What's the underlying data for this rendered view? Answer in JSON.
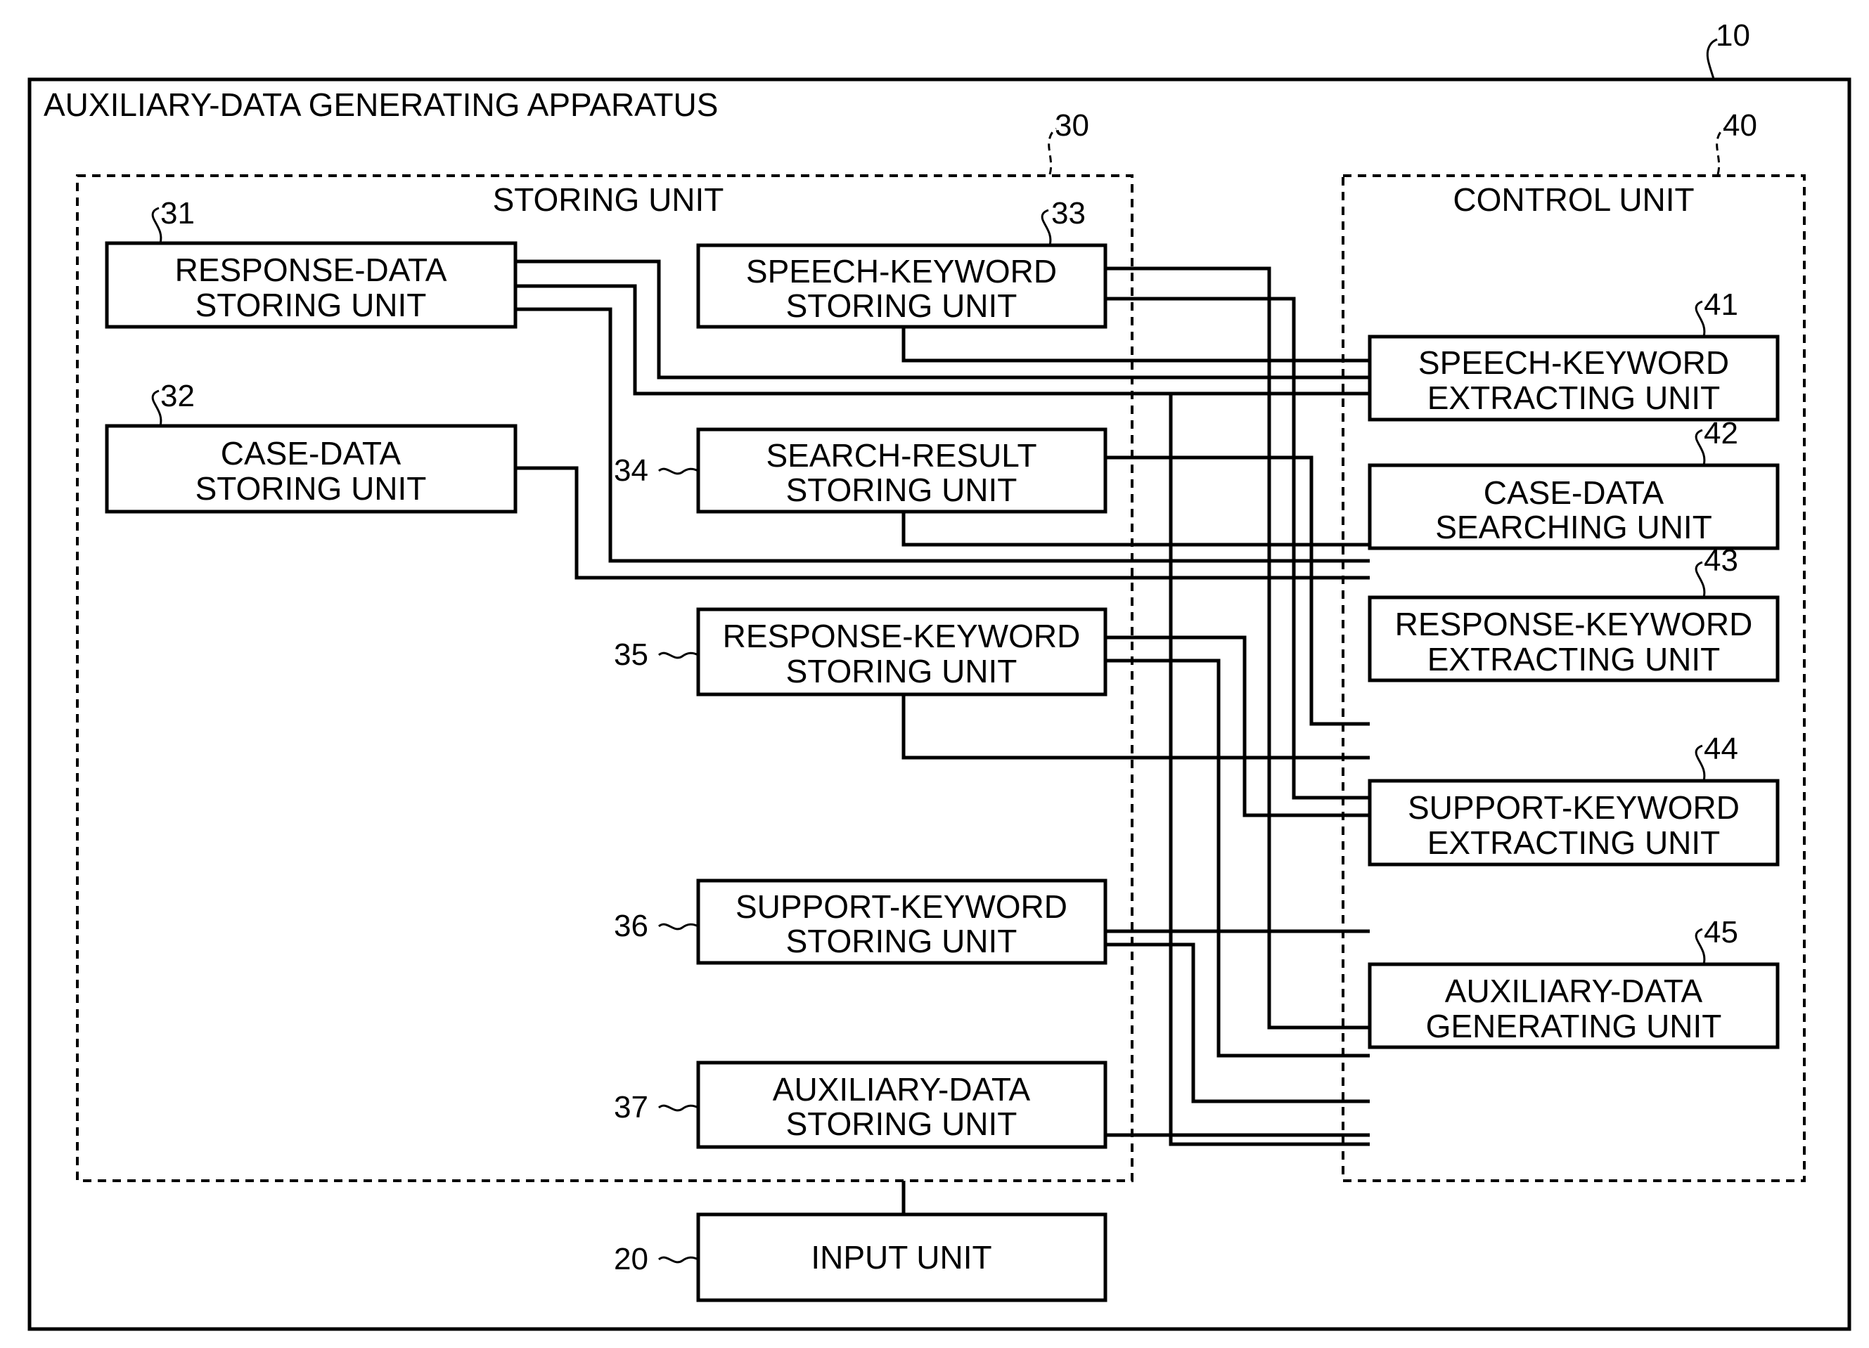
{
  "apparatus": {
    "ref": "10",
    "title": "AUXILIARY-DATA GENERATING APPARATUS"
  },
  "storing_unit": {
    "ref": "30",
    "title": "STORING UNIT",
    "blocks": [
      {
        "ref": "31",
        "line1": "RESPONSE-DATA",
        "line2": "STORING UNIT"
      },
      {
        "ref": "32",
        "line1": "CASE-DATA",
        "line2": "STORING UNIT"
      },
      {
        "ref": "33",
        "line1": "SPEECH-KEYWORD",
        "line2": "STORING UNIT"
      },
      {
        "ref": "34",
        "line1": "SEARCH-RESULT",
        "line2": "STORING UNIT"
      },
      {
        "ref": "35",
        "line1": "RESPONSE-KEYWORD",
        "line2": "STORING UNIT"
      },
      {
        "ref": "36",
        "line1": "SUPPORT-KEYWORD",
        "line2": "STORING UNIT"
      },
      {
        "ref": "37",
        "line1": "AUXILIARY-DATA",
        "line2": "STORING UNIT"
      }
    ]
  },
  "control_unit": {
    "ref": "40",
    "title": "CONTROL UNIT",
    "blocks": [
      {
        "ref": "41",
        "line1": "SPEECH-KEYWORD",
        "line2": "EXTRACTING UNIT"
      },
      {
        "ref": "42",
        "line1": "CASE-DATA",
        "line2": "SEARCHING UNIT"
      },
      {
        "ref": "43",
        "line1": "RESPONSE-KEYWORD",
        "line2": "EXTRACTING UNIT"
      },
      {
        "ref": "44",
        "line1": "SUPPORT-KEYWORD",
        "line2": "EXTRACTING UNIT"
      },
      {
        "ref": "45",
        "line1": "AUXILIARY-DATA",
        "line2": "GENERATING UNIT"
      }
    ]
  },
  "input_unit": {
    "ref": "20",
    "label": "INPUT UNIT"
  },
  "connections": [
    {
      "from": "31",
      "to": "41"
    },
    {
      "from": "31",
      "to": "42"
    },
    {
      "from": "31",
      "to": "45"
    },
    {
      "from": "32",
      "to": "42"
    },
    {
      "from": "33",
      "to": "41"
    },
    {
      "from": "33",
      "to": "43"
    },
    {
      "from": "33",
      "to": "44"
    },
    {
      "from": "34",
      "to": "42"
    },
    {
      "from": "34",
      "to": "43"
    },
    {
      "from": "35",
      "to": "43"
    },
    {
      "from": "35",
      "to": "44"
    },
    {
      "from": "35",
      "to": "45"
    },
    {
      "from": "36",
      "to": "44"
    },
    {
      "from": "36",
      "to": "45"
    },
    {
      "from": "37",
      "to": "45"
    },
    {
      "from": "20",
      "to": "30"
    }
  ]
}
